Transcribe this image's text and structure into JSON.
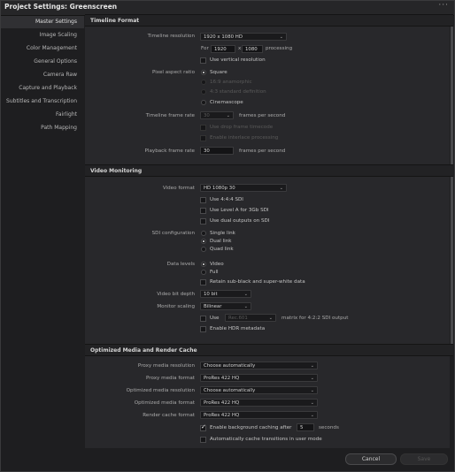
{
  "window": {
    "title": "Project Settings:  Greenscreen",
    "menu_dots": "···"
  },
  "sidebar": {
    "items": [
      {
        "label": "Master Settings"
      },
      {
        "label": "Image Scaling"
      },
      {
        "label": "Color Management"
      },
      {
        "label": "General Options"
      },
      {
        "label": "Camera Raw"
      },
      {
        "label": "Capture and Playback"
      },
      {
        "label": "Subtitles and Transcription"
      },
      {
        "label": "Fairlight"
      },
      {
        "label": "Path Mapping"
      }
    ]
  },
  "timeline_format": {
    "header": "Timeline Format",
    "resolution_label": "Timeline resolution",
    "resolution_value": "1920 x 1080 HD",
    "for_label": "For",
    "width": "1920",
    "x_label": "x",
    "height": "1080",
    "processing_label": "processing",
    "use_vertical": "Use vertical resolution",
    "par_label": "Pixel aspect ratio",
    "par_square": "Square",
    "par_169": "16:9 anamorphic",
    "par_43": "4:3 standard definition",
    "par_cinemascope": "Cinemascope",
    "frame_rate_label": "Timeline frame rate",
    "frame_rate_value": "30",
    "fps_label": "frames per second",
    "drop_frame": "Use drop frame timecode",
    "interlace": "Enable interlace processing",
    "playback_label": "Playback frame rate",
    "playback_value": "30",
    "playback_fps": "frames per second"
  },
  "video_monitoring": {
    "header": "Video Monitoring",
    "format_label": "Video format",
    "format_value": "HD 1080p 30",
    "use_444": "Use 4:4:4 SDI",
    "use_level_a": "Use Level A for 3Gb SDI",
    "use_dual": "Use dual outputs on SDI",
    "sdi_label": "SDI configuration",
    "sdi_single": "Single link",
    "sdi_dual": "Dual link",
    "sdi_quad": "Quad link",
    "data_levels_label": "Data levels",
    "levels_video": "Video",
    "levels_full": "Full",
    "retain": "Retain sub-black and super-white data",
    "bit_depth_label": "Video bit depth",
    "bit_depth_value": "10 bit",
    "scaling_label": "Monitor scaling",
    "scaling_value": "Bilinear",
    "use_label": "Use",
    "rec_value": "Rec.601",
    "matrix_label": "matrix for 4:2:2 SDI output",
    "hdr": "Enable HDR metadata"
  },
  "optimized": {
    "header": "Optimized Media and Render Cache",
    "proxy_res_label": "Proxy media resolution",
    "proxy_res_value": "Choose automatically",
    "proxy_fmt_label": "Proxy media format",
    "proxy_fmt_value": "ProRes 422 HQ",
    "opt_res_label": "Optimized media resolution",
    "opt_res_value": "Choose automatically",
    "opt_fmt_label": "Optimized media format",
    "opt_fmt_value": "ProRes 422 HQ",
    "cache_fmt_label": "Render cache format",
    "cache_fmt_value": "ProRes 422 HQ",
    "bg_cache": "Enable background caching after",
    "bg_seconds": "5",
    "seconds_label": "seconds",
    "auto_cache": "Automatically cache transitions in user mode"
  },
  "footer": {
    "cancel": "Cancel",
    "save": "Save"
  }
}
